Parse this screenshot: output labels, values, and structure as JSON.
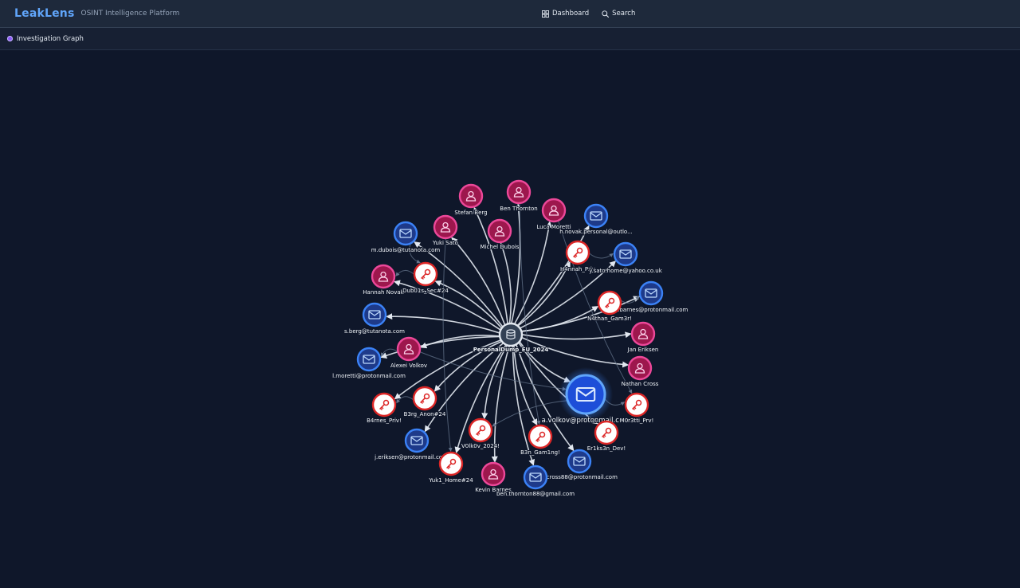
{
  "app": {
    "brand": "LeakLens",
    "tagline": "OSINT Intelligence Platform",
    "nav": [
      {
        "label": "Dashboard",
        "icon": "dashboard-icon"
      },
      {
        "label": "Search",
        "icon": "search-icon"
      }
    ]
  },
  "view": {
    "title": "Investigation Graph",
    "icon": "graph-icon"
  },
  "colors": {
    "person": "#be185d",
    "email": "#2563eb",
    "password": "#ef4444",
    "breach": "#475569"
  },
  "graph": {
    "center": {
      "id": "db",
      "label": "PersonalDump_EU_2024",
      "type": "breach"
    },
    "nodes": [
      {
        "id": "p_stefan",
        "type": "person",
        "label": "Stefan Berg"
      },
      {
        "id": "p_ben",
        "type": "person",
        "label": "Ben Thornton"
      },
      {
        "id": "p_luca",
        "type": "person",
        "label": "Luca Moretti"
      },
      {
        "id": "e_hnovak",
        "type": "email",
        "label": "h.novak.personal@outlo..."
      },
      {
        "id": "p_yuki",
        "type": "person",
        "label": "Yuki Sato"
      },
      {
        "id": "p_michel",
        "type": "person",
        "label": "Michel Dubois"
      },
      {
        "id": "e_mdubois",
        "type": "email",
        "label": "m.dubois@tutanota.com"
      },
      {
        "id": "k_hannah",
        "type": "password",
        "label": "H4nnah_Priv"
      },
      {
        "id": "e_ysato",
        "type": "email",
        "label": "y.sato.home@yahoo.co.uk"
      },
      {
        "id": "p_hannah",
        "type": "person",
        "label": "Hannah Novak"
      },
      {
        "id": "k_dub",
        "type": "password",
        "label": "Dub01s_Sec#24"
      },
      {
        "id": "e_nbarnes",
        "type": "email",
        "label": "n.barnes@protonmail.com"
      },
      {
        "id": "k_nathan",
        "type": "password",
        "label": "N4than_Gam3r!"
      },
      {
        "id": "e_sberg",
        "type": "email",
        "label": "s.berg@tutanota.com"
      },
      {
        "id": "p_jan",
        "type": "person",
        "label": "Jan Eriksen"
      },
      {
        "id": "p_alexei",
        "type": "person",
        "label": "Alexei Volkov"
      },
      {
        "id": "e_lmoretti",
        "type": "email",
        "label": "l.moretti@protonmail.com"
      },
      {
        "id": "p_nathan",
        "type": "person",
        "label": "Nathan Cross"
      },
      {
        "id": "e_avolkov",
        "type": "email",
        "label": "a.volkov@protonmail.com",
        "selected": true
      },
      {
        "id": "k_b4rnes",
        "type": "password",
        "label": "B4rnes_Priv!"
      },
      {
        "id": "k_b3rg",
        "type": "password",
        "label": "B3rg_Anon#24"
      },
      {
        "id": "k_m0r",
        "type": "password",
        "label": "M0r3tti_Prv!"
      },
      {
        "id": "k_v0lk",
        "type": "password",
        "label": "V0lk0v_2024!"
      },
      {
        "id": "k_er1k",
        "type": "password",
        "label": "Er1ks3n_Dev!"
      },
      {
        "id": "e_jeriksen",
        "type": "email",
        "label": "j.eriksen@protonmail.com"
      },
      {
        "id": "k_b3n",
        "type": "password",
        "label": "B3n_Gam1ng!"
      },
      {
        "id": "e_ncross",
        "type": "email",
        "label": "n.cross88@protonmail.com"
      },
      {
        "id": "k_yuk",
        "type": "password",
        "label": "Yuk1_Home#24"
      },
      {
        "id": "p_kevin",
        "type": "person",
        "label": "Kevin Barnes"
      },
      {
        "id": "e_bthornton",
        "type": "email",
        "label": "ben.thornton88@gmail.com"
      }
    ],
    "edges": [
      {
        "from": "db",
        "to": "p_stefan"
      },
      {
        "from": "db",
        "to": "p_ben"
      },
      {
        "from": "db",
        "to": "p_luca"
      },
      {
        "from": "db",
        "to": "e_hnovak"
      },
      {
        "from": "db",
        "to": "p_yuki"
      },
      {
        "from": "db",
        "to": "p_michel"
      },
      {
        "from": "db",
        "to": "e_mdubois"
      },
      {
        "from": "db",
        "to": "k_hannah"
      },
      {
        "from": "db",
        "to": "e_ysato"
      },
      {
        "from": "db",
        "to": "p_hannah"
      },
      {
        "from": "db",
        "to": "k_dub"
      },
      {
        "from": "db",
        "to": "e_nbarnes"
      },
      {
        "from": "db",
        "to": "k_nathan"
      },
      {
        "from": "db",
        "to": "e_sberg"
      },
      {
        "from": "db",
        "to": "p_jan"
      },
      {
        "from": "db",
        "to": "p_alexei"
      },
      {
        "from": "db",
        "to": "e_lmoretti"
      },
      {
        "from": "db",
        "to": "p_nathan"
      },
      {
        "from": "db",
        "to": "e_avolkov"
      },
      {
        "from": "db",
        "to": "k_b4rnes"
      },
      {
        "from": "db",
        "to": "k_b3rg"
      },
      {
        "from": "db",
        "to": "k_v0lk"
      },
      {
        "from": "db",
        "to": "e_jeriksen"
      },
      {
        "from": "db",
        "to": "k_b3n"
      },
      {
        "from": "db",
        "to": "e_ncross"
      },
      {
        "from": "db",
        "to": "k_yuk"
      },
      {
        "from": "db",
        "to": "p_kevin"
      },
      {
        "from": "db",
        "to": "e_bthornton"
      },
      {
        "from": "db",
        "to": "k_er1k"
      },
      {
        "from": "p_alexei",
        "to": "e_avolkov",
        "dim": true
      },
      {
        "from": "e_avolkov",
        "to": "k_v0lk",
        "dim": true
      },
      {
        "from": "p_yuki",
        "to": "k_yuk",
        "dim": true
      },
      {
        "from": "p_alexei",
        "to": "e_lmoretti",
        "dim": true
      },
      {
        "from": "e_avolkov",
        "to": "k_m0r",
        "dim": true
      },
      {
        "from": "k_b3rg",
        "to": "k_b4rnes",
        "dim": true
      },
      {
        "from": "k_dub",
        "to": "p_hannah",
        "dim": true
      },
      {
        "from": "e_mdubois",
        "to": "k_dub",
        "dim": true
      },
      {
        "from": "p_ben",
        "to": "k_b3n",
        "dim": true
      },
      {
        "from": "p_luca",
        "to": "k_m0r",
        "dim": true
      },
      {
        "from": "k_nathan",
        "to": "e_nbarnes",
        "dim": true
      },
      {
        "from": "k_hannah",
        "to": "e_ysato",
        "dim": true
      }
    ]
  }
}
